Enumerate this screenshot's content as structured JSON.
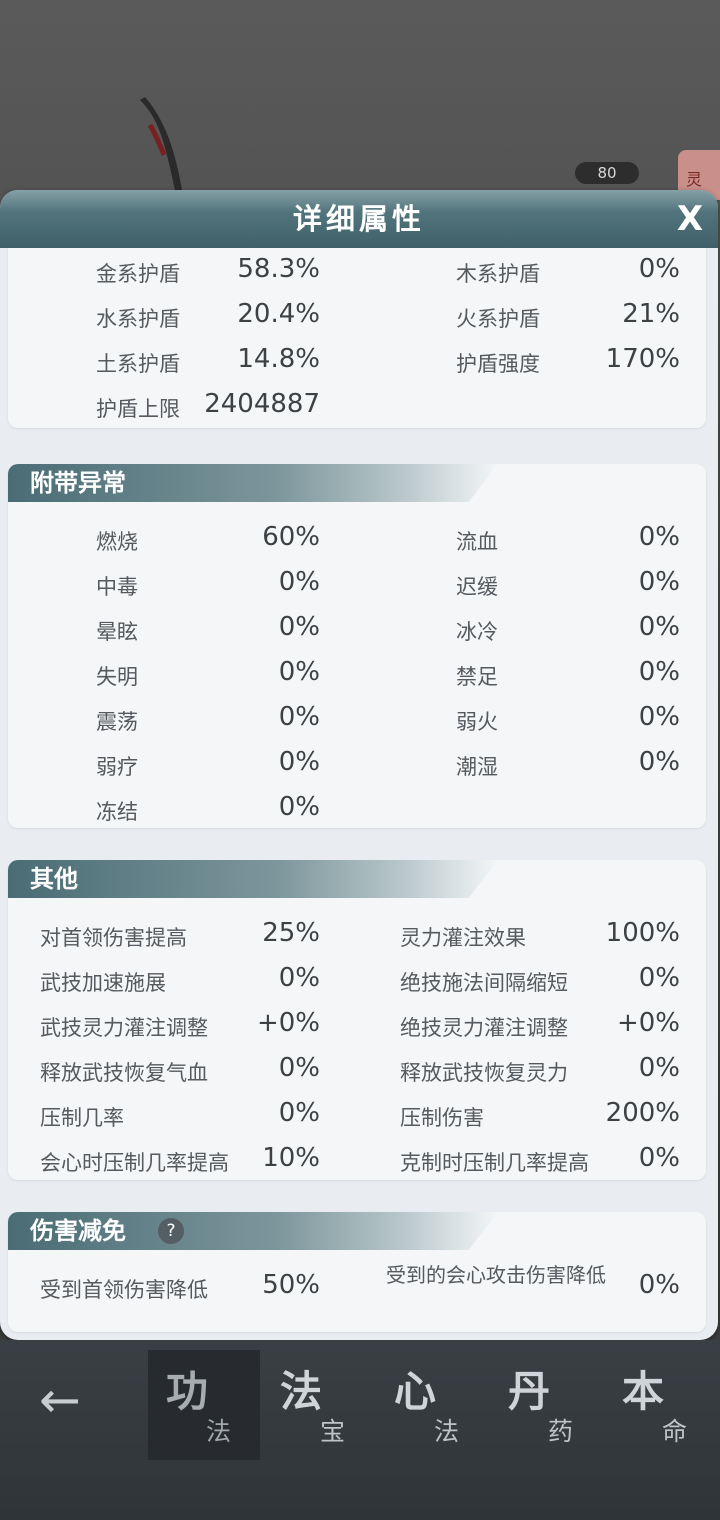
{
  "background": {
    "level_badge": "80",
    "side_tag": "灵"
  },
  "panel": {
    "title": "详细属性",
    "close_label": "X"
  },
  "shield": {
    "rows": [
      {
        "label": "金系护盾",
        "value": "58.3%"
      },
      {
        "label": "木系护盾",
        "value": "0%"
      },
      {
        "label": "水系护盾",
        "value": "20.4%"
      },
      {
        "label": "火系护盾",
        "value": "21%"
      },
      {
        "label": "土系护盾",
        "value": "14.8%"
      },
      {
        "label": "护盾强度",
        "value": "170%"
      },
      {
        "label": "护盾上限",
        "value": "2404887"
      }
    ]
  },
  "abnormal": {
    "title": "附带异常",
    "rows": [
      {
        "label": "燃烧",
        "value": "60%"
      },
      {
        "label": "流血",
        "value": "0%"
      },
      {
        "label": "中毒",
        "value": "0%"
      },
      {
        "label": "迟缓",
        "value": "0%"
      },
      {
        "label": "晕眩",
        "value": "0%"
      },
      {
        "label": "冰冷",
        "value": "0%"
      },
      {
        "label": "失明",
        "value": "0%"
      },
      {
        "label": "禁足",
        "value": "0%"
      },
      {
        "label": "震荡",
        "value": "0%"
      },
      {
        "label": "弱火",
        "value": "0%"
      },
      {
        "label": "弱疗",
        "value": "0%"
      },
      {
        "label": "潮湿",
        "value": "0%"
      },
      {
        "label": "冻结",
        "value": "0%"
      }
    ]
  },
  "other": {
    "title": "其他",
    "rows": [
      {
        "label": "对首领伤害提高",
        "value": "25%"
      },
      {
        "label": "灵力灌注效果",
        "value": "100%"
      },
      {
        "label": "武技加速施展",
        "value": "0%"
      },
      {
        "label": "绝技施法间隔缩短",
        "value": "0%"
      },
      {
        "label": "武技灵力灌注调整",
        "value": "+0%"
      },
      {
        "label": "绝技灵力灌注调整",
        "value": "+0%"
      },
      {
        "label": "释放武技恢复气血",
        "value": "0%"
      },
      {
        "label": "释放武技恢复灵力",
        "value": "0%"
      },
      {
        "label": "压制几率",
        "value": "0%"
      },
      {
        "label": "压制伤害",
        "value": "200%"
      },
      {
        "label": "会心时压制几率提高",
        "value": "10%"
      },
      {
        "label": "克制时压制几率提高",
        "value": "0%"
      }
    ]
  },
  "reduction": {
    "title": "伤害减免",
    "help_icon": "?",
    "rows": [
      {
        "label": "受到首领伤害降低",
        "value": "50%"
      },
      {
        "label": "受到的会心攻击伤害降低",
        "value": "0%"
      }
    ]
  },
  "bottom_nav": {
    "tabs": [
      {
        "big": "功",
        "small": "法"
      },
      {
        "big": "法",
        "small": "宝"
      },
      {
        "big": "心",
        "small": "法"
      },
      {
        "big": "丹",
        "small": "药"
      },
      {
        "big": "本",
        "small": "命"
      }
    ]
  }
}
